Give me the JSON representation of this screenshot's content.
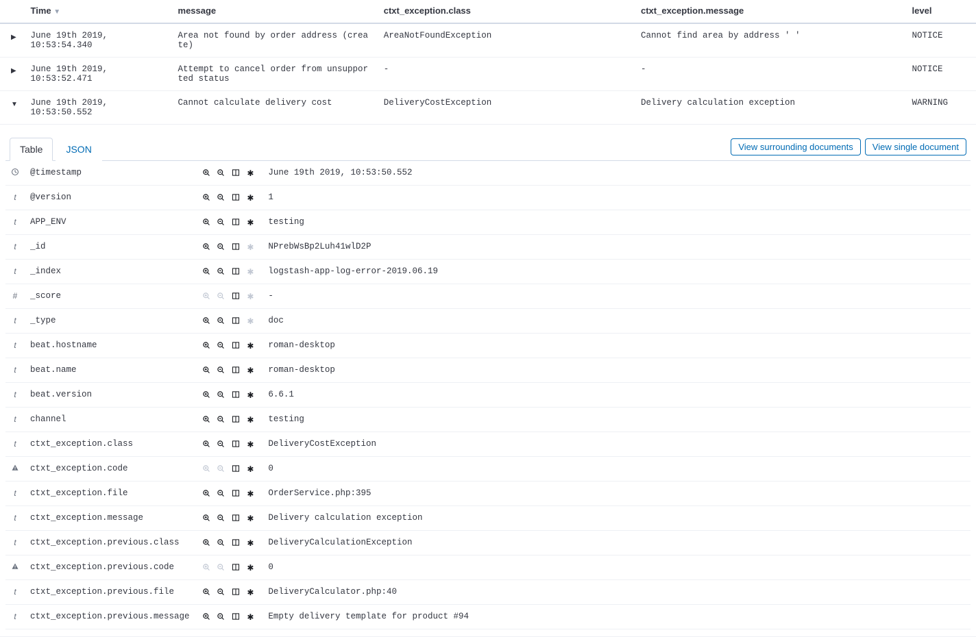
{
  "columns": {
    "time": "Time",
    "message": "message",
    "class": "ctxt_exception.class",
    "emsg": "ctxt_exception.message",
    "level": "level"
  },
  "rows": [
    {
      "expanded": false,
      "time": "June 19th 2019, 10:53:54.340",
      "message": "Area not found by order address (create)",
      "class": "AreaNotFoundException",
      "emsg": "Cannot find area by address '                '",
      "level": "NOTICE"
    },
    {
      "expanded": false,
      "time": "June 19th 2019, 10:53:52.471",
      "message": "Attempt to cancel order from unsupported status",
      "class": "-",
      "emsg": "-",
      "level": "NOTICE"
    },
    {
      "expanded": true,
      "time": "June 19th 2019, 10:53:50.552",
      "message": "Cannot calculate delivery cost",
      "class": "DeliveryCostException",
      "emsg": "Delivery calculation exception",
      "level": "WARNING"
    }
  ],
  "tabs": {
    "table": "Table",
    "json": "JSON"
  },
  "buttons": {
    "surrounding": "View surrounding documents",
    "single": "View single document"
  },
  "fields": [
    {
      "type": "clock",
      "name": "@timestamp",
      "value": "June 19th 2019, 10:53:50.552",
      "dim": false
    },
    {
      "type": "t",
      "name": "@version",
      "value": "1",
      "dim": false
    },
    {
      "type": "t",
      "name": "APP_ENV",
      "value": "testing",
      "dim": false
    },
    {
      "type": "t",
      "name": "_id",
      "value": "NPrebWsBp2Luh41wlD2P",
      "dim": true
    },
    {
      "type": "t",
      "name": "_index",
      "value": "logstash-app-log-error-2019.06.19",
      "dim": true
    },
    {
      "type": "#",
      "name": "_score",
      "value": " - ",
      "dim": true,
      "dimZoom": true
    },
    {
      "type": "t",
      "name": "_type",
      "value": "doc",
      "dim": true
    },
    {
      "type": "t",
      "name": "beat.hostname",
      "value": "roman-desktop",
      "dim": false
    },
    {
      "type": "t",
      "name": "beat.name",
      "value": "roman-desktop",
      "dim": false
    },
    {
      "type": "t",
      "name": "beat.version",
      "value": "6.6.1",
      "dim": false
    },
    {
      "type": "t",
      "name": "channel",
      "value": "testing",
      "dim": false
    },
    {
      "type": "t",
      "name": "ctxt_exception.class",
      "value": "DeliveryCostException",
      "dim": false
    },
    {
      "type": "warn",
      "name": "ctxt_exception.code",
      "value": "0",
      "dim": false,
      "dimZoom": true
    },
    {
      "type": "t",
      "name": "ctxt_exception.file",
      "value": "OrderService.php:395",
      "dim": false
    },
    {
      "type": "t",
      "name": "ctxt_exception.message",
      "value": "Delivery calculation exception",
      "dim": false
    },
    {
      "type": "t",
      "name": "ctxt_exception.previous.class",
      "value": "DeliveryCalculationException",
      "dim": false
    },
    {
      "type": "warn",
      "name": "ctxt_exception.previous.code",
      "value": "0",
      "dim": false,
      "dimZoom": true
    },
    {
      "type": "t",
      "name": "ctxt_exception.previous.file",
      "value": "DeliveryCalculator.php:40",
      "dim": false
    },
    {
      "type": "t",
      "name": "ctxt_exception.previous.message",
      "value": "Empty delivery template for product #94",
      "dim": false
    }
  ]
}
